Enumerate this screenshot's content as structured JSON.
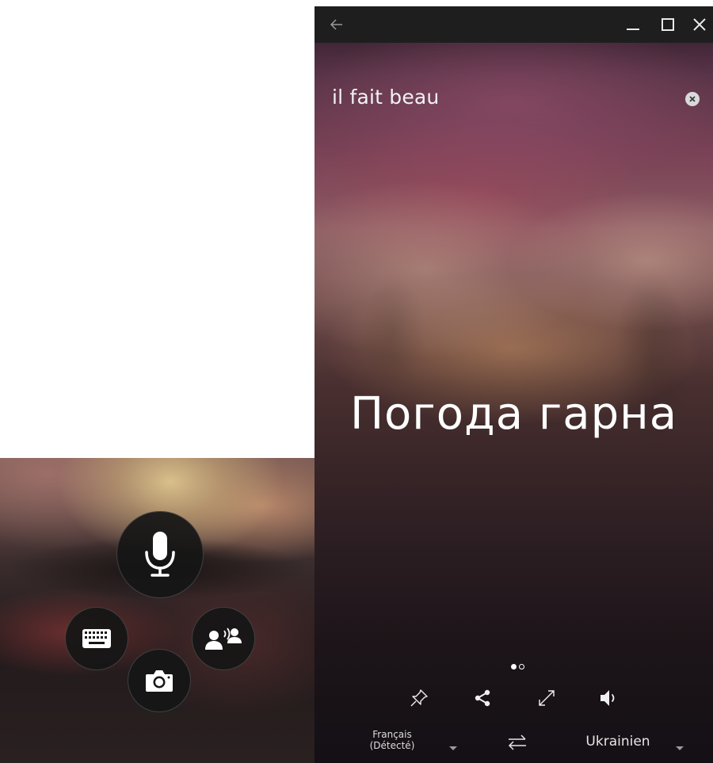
{
  "window": {
    "back_icon": "back-arrow-icon",
    "minimize_icon": "minimize-icon",
    "maximize_icon": "maximize-icon",
    "close_icon": "close-icon"
  },
  "translation": {
    "source_text": "il fait beau",
    "translated_text": "Погода гарна",
    "clear_icon": "clear-icon"
  },
  "pager": {
    "current": 1,
    "total": 2
  },
  "actions": [
    {
      "icon": "pin-icon"
    },
    {
      "icon": "share-icon"
    },
    {
      "icon": "expand-icon"
    },
    {
      "icon": "speaker-icon"
    }
  ],
  "languages": {
    "source_line1": "Français",
    "source_line2": "(Détecté)",
    "swap_icon": "swap-icon",
    "target": "Ukrainien"
  },
  "input_picker": {
    "buttons": [
      {
        "icon": "microphone-icon"
      },
      {
        "icon": "keyboard-icon"
      },
      {
        "icon": "camera-icon"
      },
      {
        "icon": "conversation-icon"
      }
    ]
  },
  "colors": {
    "titlebar": "#1e1e1e",
    "text": "#ffffff",
    "fab": "#161616"
  }
}
